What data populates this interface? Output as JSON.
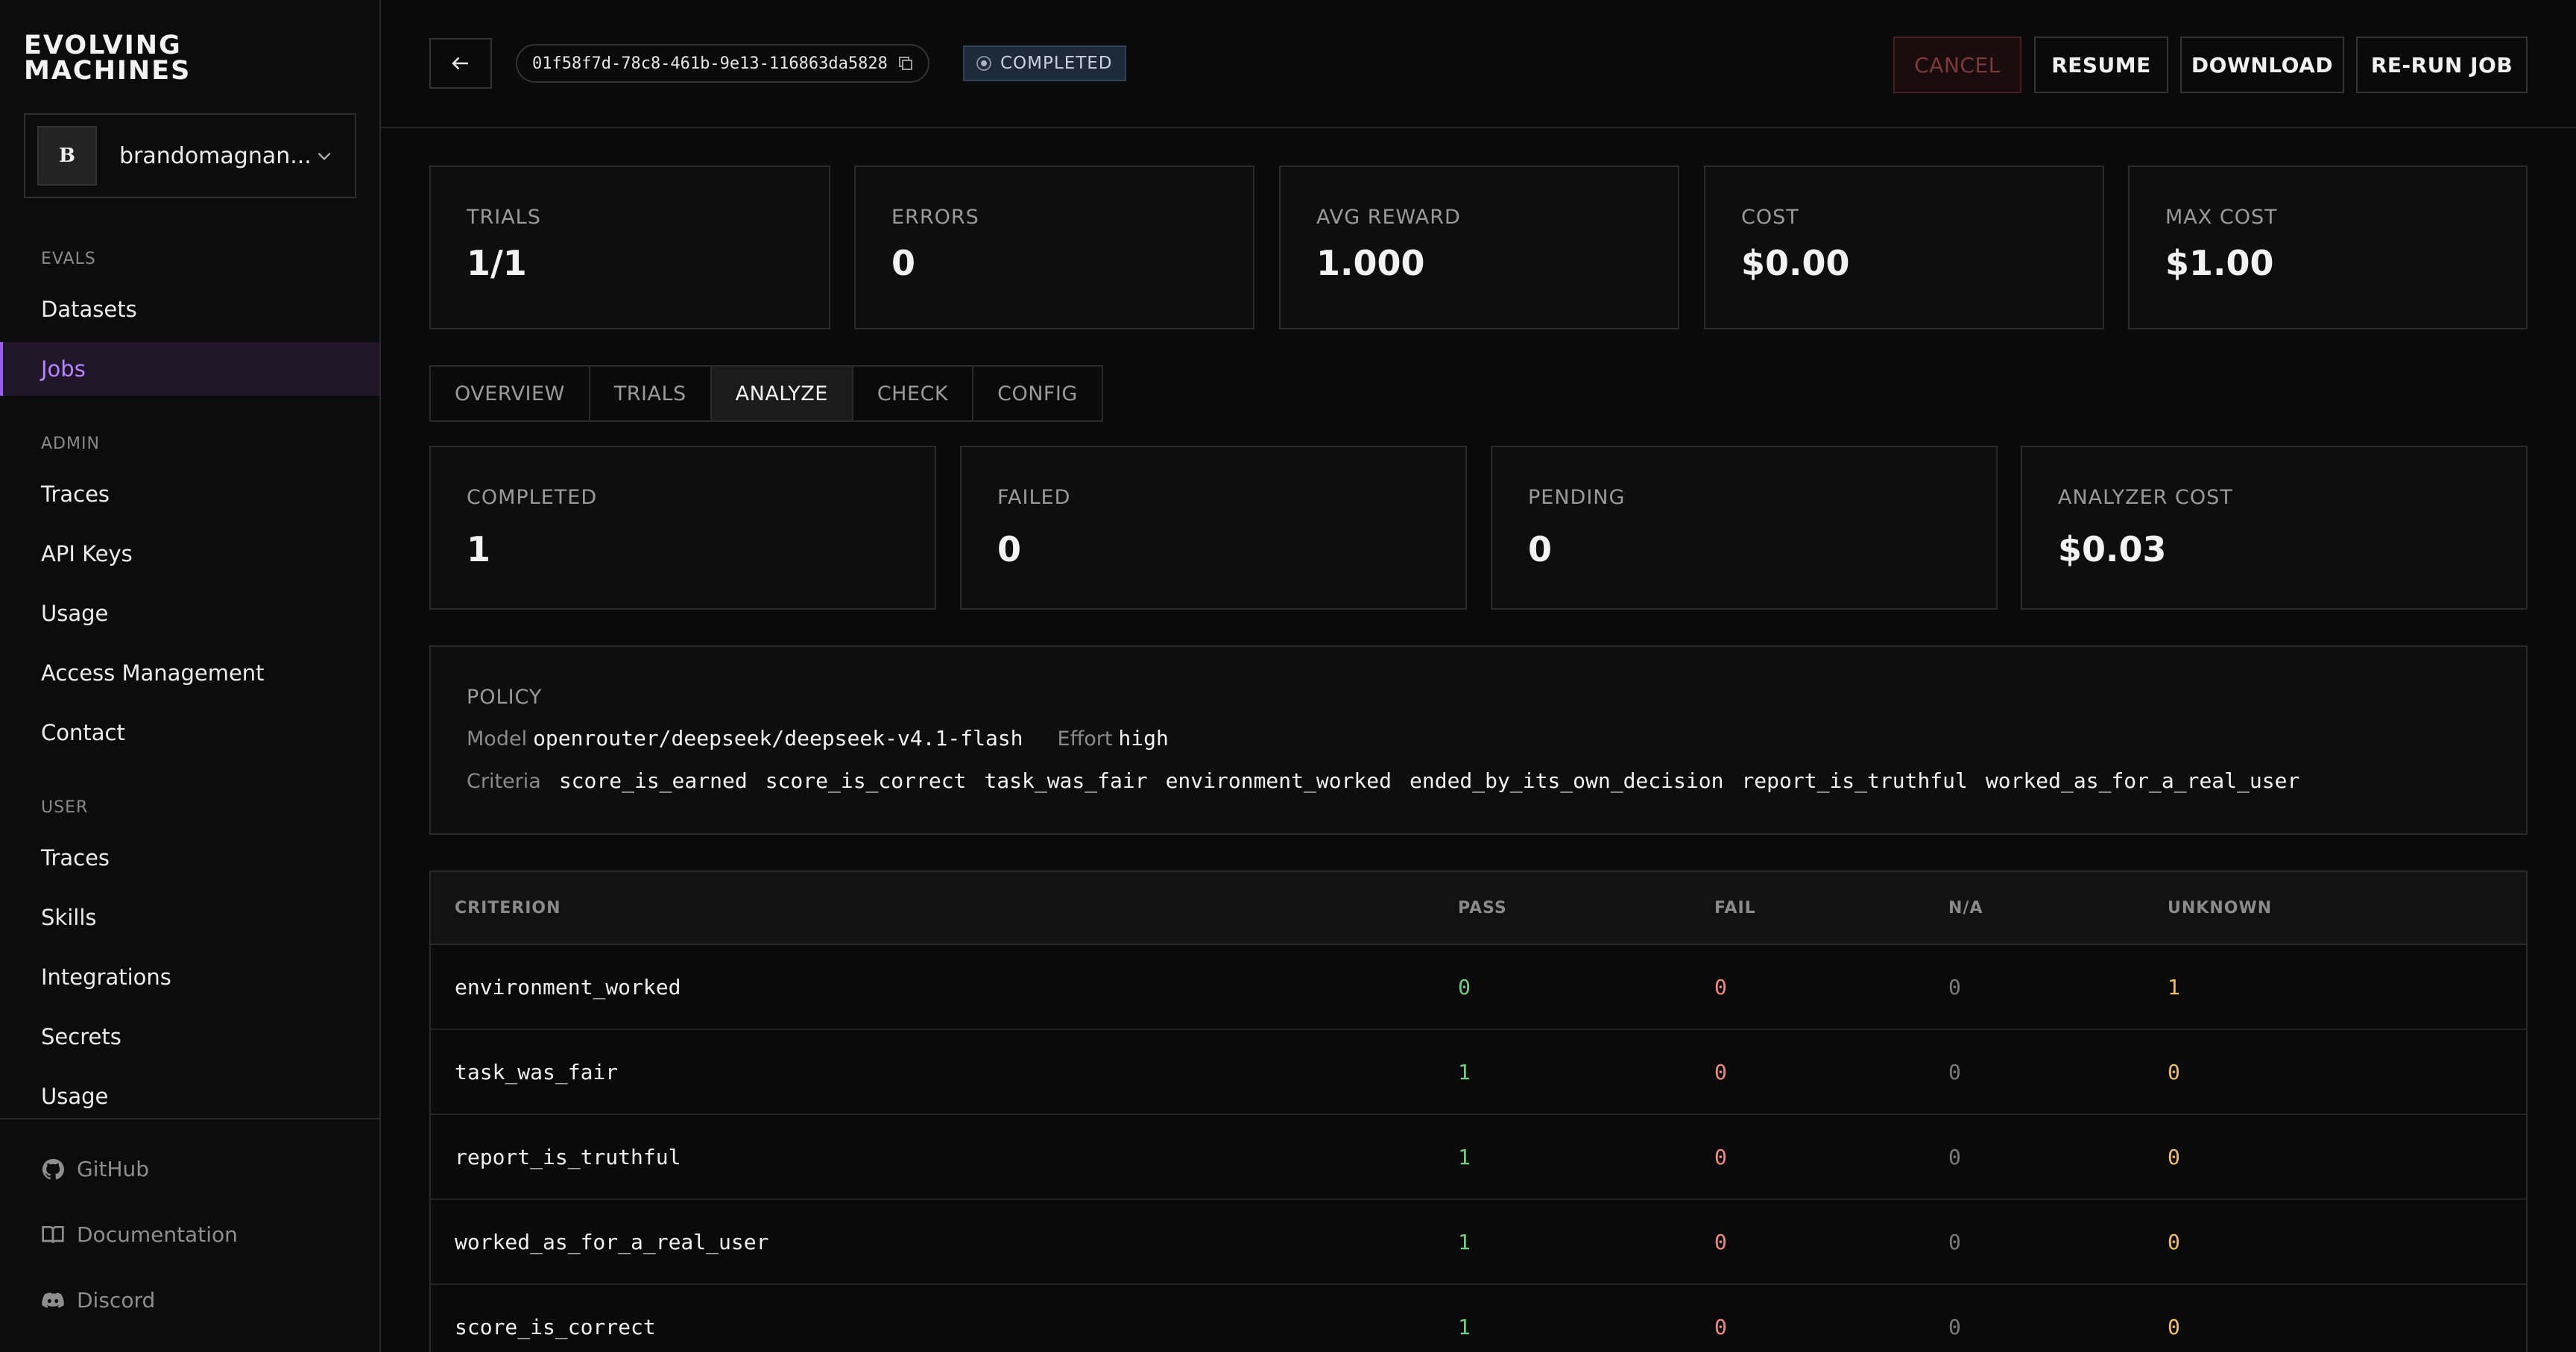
{
  "app": {
    "logo_line1": "EVOLVING",
    "logo_line2": "MACHINES"
  },
  "org": {
    "initial": "B",
    "name": "brandomagnan..."
  },
  "sidebar": {
    "evals_label": "EVALS",
    "evals_items": [
      "Datasets",
      "Jobs"
    ],
    "admin_label": "ADMIN",
    "admin_items": [
      "Traces",
      "API Keys",
      "Usage",
      "Access Management",
      "Contact"
    ],
    "user_label": "USER",
    "user_items": [
      "Traces",
      "Skills",
      "Integrations",
      "Secrets",
      "Usage"
    ],
    "footer": [
      "GitHub",
      "Documentation",
      "Discord"
    ],
    "active_item": "Jobs"
  },
  "header": {
    "job_id": "01f58f7d-78c8-461b-9e13-116863da5828",
    "status": "COMPLETED",
    "buttons": {
      "cancel": "CANCEL",
      "resume": "RESUME",
      "download": "DOWNLOAD",
      "rerun": "RE-RUN JOB"
    }
  },
  "stats": [
    {
      "label": "TRIALS",
      "value": "1/1"
    },
    {
      "label": "ERRORS",
      "value": "0"
    },
    {
      "label": "AVG REWARD",
      "value": "1.000"
    },
    {
      "label": "COST",
      "value": "$0.00"
    },
    {
      "label": "MAX COST",
      "value": "$1.00"
    }
  ],
  "tabs": [
    "OVERVIEW",
    "TRIALS",
    "ANALYZE",
    "CHECK",
    "CONFIG"
  ],
  "active_tab": "ANALYZE",
  "analyze_stats": [
    {
      "label": "COMPLETED",
      "value": "1"
    },
    {
      "label": "FAILED",
      "value": "0"
    },
    {
      "label": "PENDING",
      "value": "0"
    },
    {
      "label": "ANALYZER COST",
      "value": "$0.03"
    }
  ],
  "policy": {
    "title": "POLICY",
    "model_label": "Model",
    "model": "openrouter/deepseek/deepseek-v4.1-flash",
    "effort_label": "Effort",
    "effort": "high",
    "criteria_label": "Criteria",
    "criteria": [
      "score_is_earned",
      "score_is_correct",
      "task_was_fair",
      "environment_worked",
      "ended_by_its_own_decision",
      "report_is_truthful",
      "worked_as_for_a_real_user"
    ]
  },
  "table": {
    "headers": [
      "CRITERION",
      "PASS",
      "FAIL",
      "N/A",
      "UNKNOWN"
    ],
    "rows": [
      {
        "criterion": "environment_worked",
        "pass": "0",
        "fail": "0",
        "na": "0",
        "unknown": "1"
      },
      {
        "criterion": "task_was_fair",
        "pass": "1",
        "fail": "0",
        "na": "0",
        "unknown": "0"
      },
      {
        "criterion": "report_is_truthful",
        "pass": "1",
        "fail": "0",
        "na": "0",
        "unknown": "0"
      },
      {
        "criterion": "worked_as_for_a_real_user",
        "pass": "1",
        "fail": "0",
        "na": "0",
        "unknown": "0"
      },
      {
        "criterion": "score_is_correct",
        "pass": "1",
        "fail": "0",
        "na": "0",
        "unknown": "0"
      }
    ]
  },
  "colors": {
    "accent": "#9b5cf0",
    "pass": "#6fcf7f",
    "fail": "#f08a7a",
    "unknown": "#f0c060"
  }
}
